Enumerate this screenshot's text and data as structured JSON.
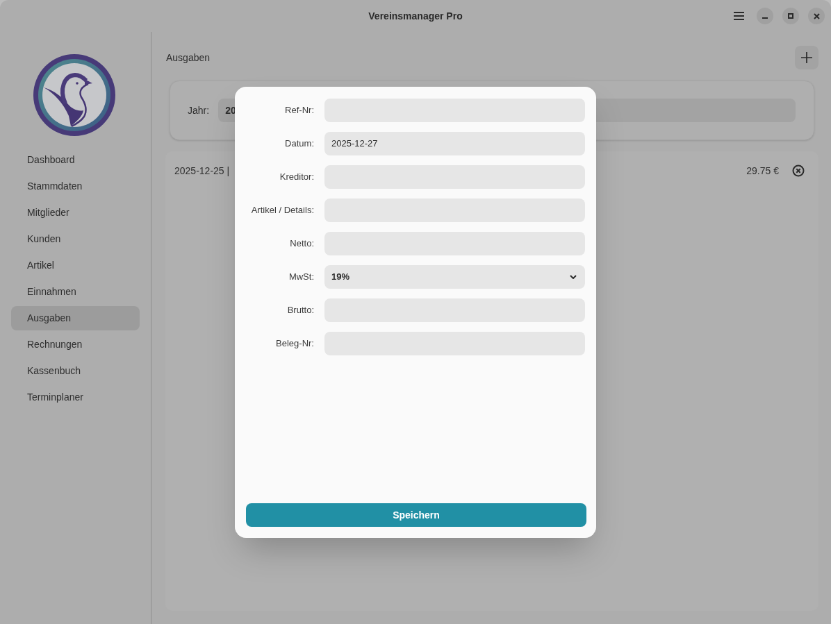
{
  "window": {
    "title": "Vereinsmanager Pro"
  },
  "sidebar": {
    "items": [
      {
        "label": "Dashboard",
        "selected": false
      },
      {
        "label": "Stammdaten",
        "selected": false
      },
      {
        "label": "Mitglieder",
        "selected": false
      },
      {
        "label": "Kunden",
        "selected": false
      },
      {
        "label": "Artikel",
        "selected": false
      },
      {
        "label": "Einnahmen",
        "selected": false
      },
      {
        "label": "Ausgaben",
        "selected": true
      },
      {
        "label": "Rechnungen",
        "selected": false
      },
      {
        "label": "Kassenbuch",
        "selected": false
      },
      {
        "label": "Terminplaner",
        "selected": false
      }
    ]
  },
  "main": {
    "title": "Ausgaben",
    "year_filter": {
      "label": "Jahr:",
      "value": "20"
    },
    "expenses": [
      {
        "summary": "2025-12-25 |",
        "amount": "29.75 €"
      }
    ]
  },
  "dialog": {
    "fields": [
      {
        "label": "Ref-Nr:",
        "kind": "text"
      },
      {
        "label": "Datum:",
        "kind": "text",
        "value": "2025-12-27"
      },
      {
        "label": "Kreditor:",
        "kind": "text"
      },
      {
        "label": "Artikel / Details:",
        "kind": "text"
      },
      {
        "label": "Netto:",
        "kind": "text"
      },
      {
        "label": "MwSt:",
        "kind": "select",
        "value": "19%"
      },
      {
        "label": "Brutto:",
        "kind": "text"
      },
      {
        "label": "Beleg-Nr:",
        "kind": "text"
      }
    ],
    "save_button": "Speichern"
  }
}
